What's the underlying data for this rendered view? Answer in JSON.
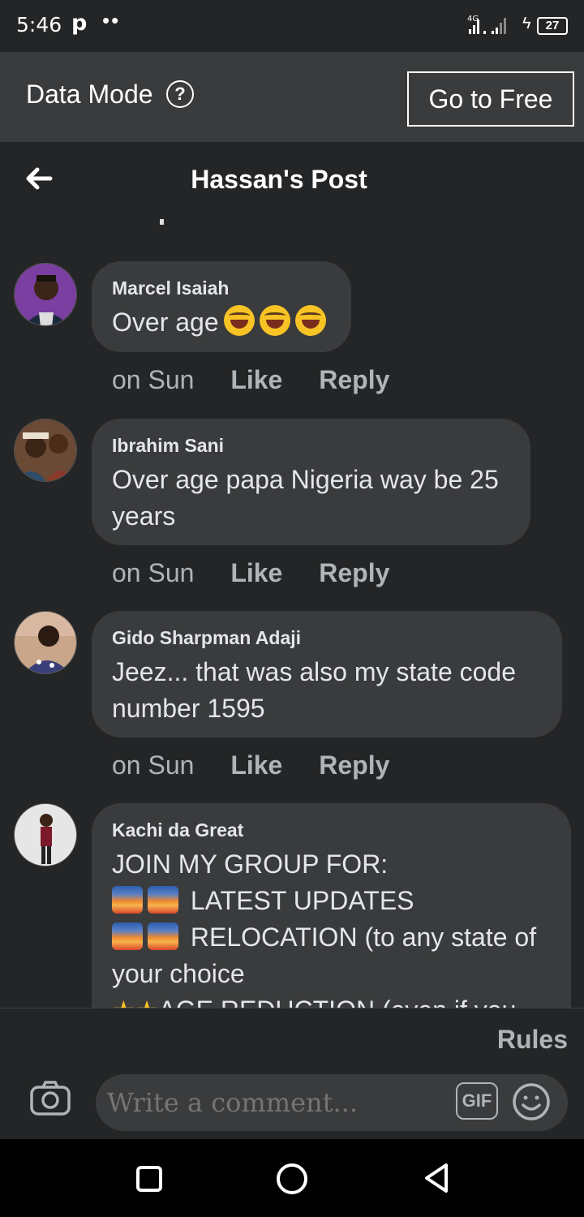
{
  "status": {
    "time": "5:46",
    "left_icons": "p ••",
    "network": "4G",
    "battery": "27"
  },
  "data_mode": {
    "label": "Data Mode",
    "button": "Go to Free"
  },
  "header": {
    "title": "Hassan's Post"
  },
  "comments": [
    {
      "author": "Marcel Isaiah",
      "text": "Over age",
      "emojis": [
        "laughing-with-tears",
        "laughing-with-tears",
        "laughing-with-tears"
      ],
      "time": "on Sun",
      "like": "Like",
      "reply": "Reply"
    },
    {
      "author": "Ibrahim Sani",
      "text": "Over age papa Nigeria way be 25 years",
      "time": "on Sun",
      "like": "Like",
      "reply": "Reply"
    },
    {
      "author": "Gido Sharpman Adaji",
      "text": "Jeez... that was also my state code number 1595",
      "time": "on Sun",
      "like": "Like",
      "reply": "Reply"
    },
    {
      "author": "Kachi da Great",
      "lines": [
        "JOIN MY GROUP FOR:",
        "LATEST UPDATES",
        "RELOCATION (to any state of your choice",
        "AGE REDUCTION (even if you"
      ]
    }
  ],
  "footer": {
    "rules": "Rules",
    "comment_placeholder": "Write a comment...",
    "gif": "GIF"
  },
  "colors": {
    "background": "#242526",
    "bubble": "#3a3b3c",
    "data_bar": "#3a3b3c",
    "text_primary": "#e4e6eb",
    "text_secondary": "#b0b3b8"
  }
}
